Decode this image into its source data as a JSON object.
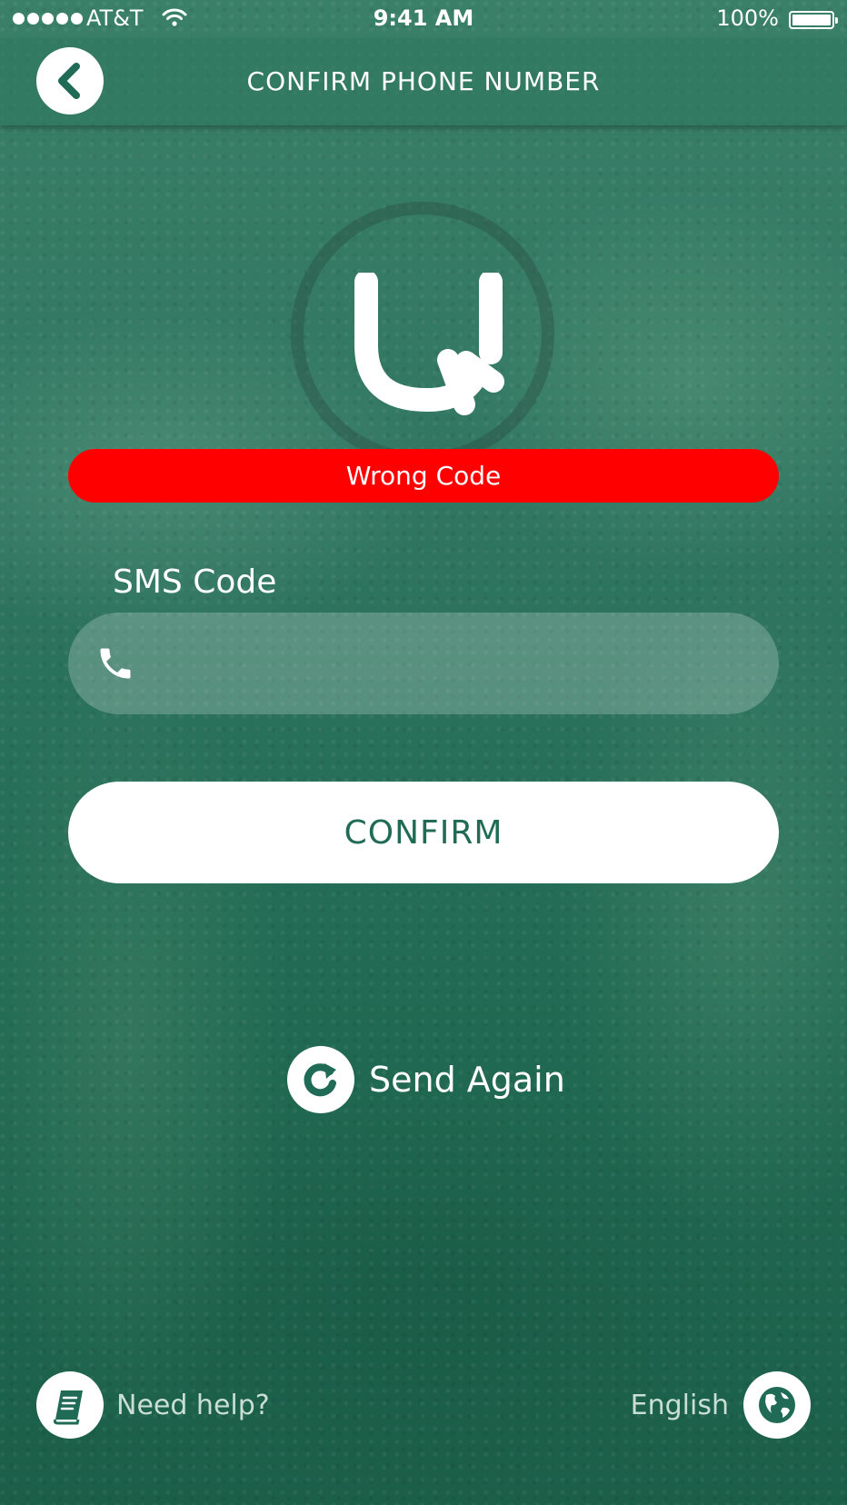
{
  "status_bar": {
    "carrier": "AT&T",
    "time": "9:41 AM",
    "battery": "100%"
  },
  "nav": {
    "title": "CONFIRM PHONE NUMBER",
    "back_icon": "chevron-left-icon"
  },
  "error": {
    "message": "Wrong Code",
    "color": "#ff0000"
  },
  "form": {
    "sms_label": "SMS Code",
    "sms_value": "",
    "phone_icon": "phone-icon",
    "confirm_label": "CONFIRM"
  },
  "send_again": {
    "label": "Send Again",
    "icon": "refresh-icon"
  },
  "footer": {
    "help_label": "Need help?",
    "help_icon": "book-icon",
    "language_label": "English",
    "language_icon": "globe-icon"
  },
  "colors": {
    "brand_green": "#1f6b55",
    "error_red": "#ff0000"
  }
}
